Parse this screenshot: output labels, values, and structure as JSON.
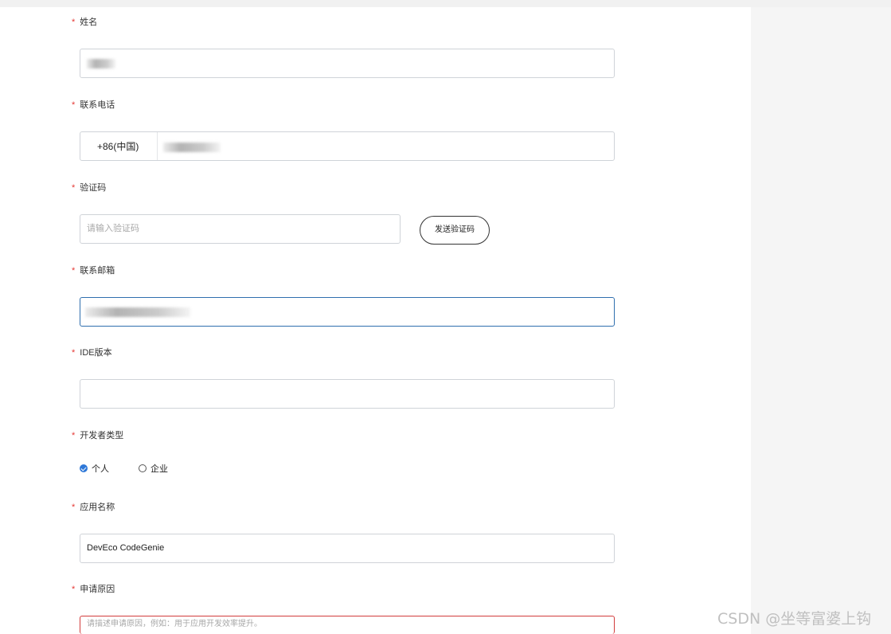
{
  "form": {
    "name": {
      "label": "姓名",
      "required_mark": "*"
    },
    "phone": {
      "label": "联系电话",
      "required_mark": "*",
      "country_code": "+86(中国)"
    },
    "code": {
      "label": "验证码",
      "required_mark": "*",
      "placeholder": "请输入验证码",
      "send_button": "发送验证码"
    },
    "email": {
      "label": "联系邮箱",
      "required_mark": "*"
    },
    "ide": {
      "label": "IDE版本",
      "required_mark": "*",
      "value": ""
    },
    "dev_type": {
      "label": "开发者类型",
      "required_mark": "*",
      "options": [
        {
          "label": "个人",
          "checked": true
        },
        {
          "label": "企业",
          "checked": false
        }
      ]
    },
    "app_name": {
      "label": "应用名称",
      "required_mark": "*",
      "value": "DevEco CodeGenie"
    },
    "reason": {
      "label": "申请原因",
      "required_mark": "*",
      "placeholder": "请描述申请原因，例如：用于应用开发效率提升。"
    }
  },
  "watermark": "CSDN @坐等富婆上钩",
  "colors": {
    "required": "#e53935",
    "focus_border": "#2f6fae",
    "error_border": "#d23c3c",
    "radio_checked": "#2f78d8"
  }
}
